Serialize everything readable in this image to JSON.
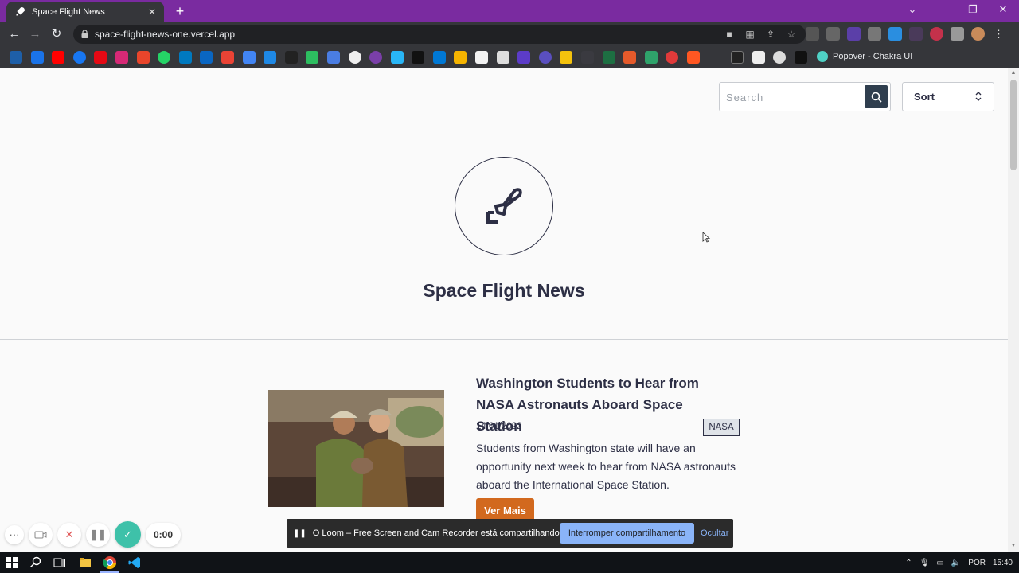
{
  "browser": {
    "tab_title": "Space Flight News",
    "new_tab": "+",
    "url": "space-flight-news-one.vercel.app",
    "bookmark_popover_label": "Popover - Chakra UI"
  },
  "header": {
    "search_placeholder": "Search",
    "sort_label": "Sort"
  },
  "site": {
    "title": "Space Flight News"
  },
  "article": {
    "title": "Washington Students to Hear from NASA Astronauts Aboard Space Station",
    "date": "14/01/2022",
    "tag": "NASA",
    "summary": "Students from Washington state will have an opportunity next week to hear from NASA astronauts aboard the International Space Station.",
    "button": "Ver Mais"
  },
  "loom": {
    "timer": "0:00",
    "more": "···",
    "share_message": "O Loom – Free Screen and Cam Recorder está compartilhando sua tela.",
    "stop_label": "Interromper compartilhamento",
    "hide_label": "Ocultar"
  },
  "taskbar": {
    "language": "POR",
    "time": "15:40"
  },
  "colors": {
    "tab_strip": "#7a2ba0",
    "brand_dark": "#2d2f45",
    "accent_button": "#d2691e",
    "loom_check": "#3ec1a9"
  }
}
